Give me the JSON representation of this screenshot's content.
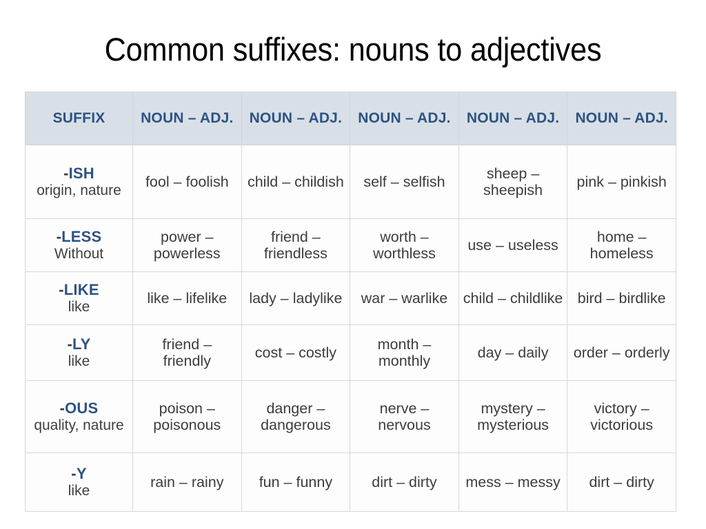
{
  "slide": {
    "title": "Common suffixes: nouns to adjectives"
  },
  "table": {
    "headers": [
      "SUFFIX",
      "NOUN – ADJ.",
      "NOUN – ADJ.",
      "NOUN – ADJ.",
      "NOUN – ADJ.",
      "NOUN – ADJ."
    ],
    "header_colors": {
      "background": "#d8dfe7",
      "text": "#2d5383"
    },
    "rows": [
      {
        "suffix": "-ISH",
        "suffix_dash": "-",
        "suffix_letters": "ISH",
        "meaning": "origin, nature",
        "examples": [
          "fool – foolish",
          "child – childish",
          "self – selfish",
          "sheep – sheepish",
          "pink – pinkish"
        ]
      },
      {
        "suffix": "-LESS",
        "suffix_dash": "-",
        "suffix_letters": "LESS",
        "meaning": "Without",
        "examples": [
          "power – powerless",
          "friend – friendless",
          "worth – worthless",
          "use – useless",
          "home – homeless"
        ]
      },
      {
        "suffix": "-LIKE",
        "suffix_dash": "-",
        "suffix_letters": "LIKE",
        "meaning": "like",
        "examples": [
          "like – lifelike",
          "lady – ladylike",
          "war – warlike",
          "child – childlike",
          "bird – birdlike"
        ]
      },
      {
        "suffix": "-LY",
        "suffix_dash": "-",
        "suffix_letters": "LY",
        "meaning": "like",
        "examples": [
          "friend – friendly",
          "cost – costly",
          "month – monthly",
          "day – daily",
          "order – orderly"
        ]
      },
      {
        "suffix": "-OUS",
        "suffix_dash": "-",
        "suffix_letters": "OUS",
        "meaning": "quality, nature",
        "examples": [
          "poison – poisonous",
          "danger – dangerous",
          "nerve – nervous",
          "mystery – mysterious",
          "victory – victorious"
        ]
      },
      {
        "suffix": "-Y",
        "suffix_dash": "-",
        "suffix_letters": "Y",
        "meaning": "like",
        "examples": [
          "rain – rainy",
          "fun – funny",
          "dirt – dirty",
          "mess – messy",
          "dirt – dirty"
        ]
      }
    ]
  }
}
